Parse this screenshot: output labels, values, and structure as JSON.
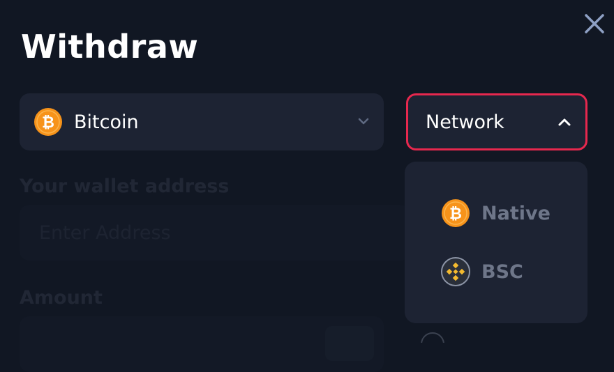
{
  "title": "Withdraw",
  "coin_select": {
    "selected": "Bitcoin",
    "icon": "bitcoin-icon"
  },
  "network_select": {
    "label": "Network",
    "icon": "chevron-up-icon",
    "accent": "#e7284e"
  },
  "wallet": {
    "label": "Your wallet address",
    "placeholder": "Enter Address"
  },
  "amount": {
    "label": "Amount"
  },
  "network_options": [
    {
      "name": "Native",
      "icon": "bitcoin-icon"
    },
    {
      "name": "BSC",
      "icon": "bnb-icon"
    }
  ],
  "colors": {
    "bitcoin": "#f7931a",
    "bnb": "#f3ba2f",
    "background": "#111723",
    "panel": "#1d2333"
  }
}
